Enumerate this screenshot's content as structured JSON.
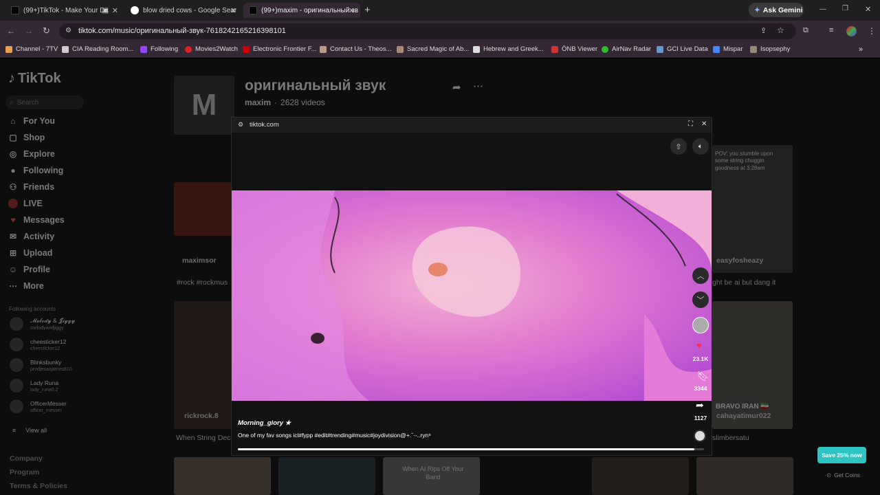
{
  "browser": {
    "tabs": [
      {
        "title": "(99+)TikTok - Make Your Da",
        "active": false
      },
      {
        "title": "blow dried cows - Google Sear",
        "active": false
      },
      {
        "title": "(99+)maxim - оригинальный зв",
        "active": true
      }
    ],
    "new_tab": "+",
    "ask_gemini": "Ask Gemini",
    "url": "tiktok.com/music/оригинальный-звук-7618242165216398101",
    "bookmarks": [
      "Channel - 7TV",
      "CIA Reading Room...",
      "Following",
      "Movies2Watch",
      "Electronic Frontier F...",
      "Contact Us - Theos...",
      "Sacred Magic of Ab...",
      "Hebrew and Greek...",
      "ÖNB Viewer",
      "AirNav Radar",
      "GCI Live Data",
      "Mispar",
      "Isopsephy"
    ],
    "bookmarks_more": "»"
  },
  "sidebar": {
    "logo": "TikTok",
    "search_placeholder": "Search",
    "nav": [
      {
        "label": "For You",
        "icon": "home-icon"
      },
      {
        "label": "Shop",
        "icon": "shop-icon"
      },
      {
        "label": "Explore",
        "icon": "compass-icon"
      },
      {
        "label": "Following",
        "icon": "following-icon"
      },
      {
        "label": "Friends",
        "icon": "friends-icon"
      },
      {
        "label": "LIVE",
        "icon": "live-icon"
      },
      {
        "label": "Messages",
        "icon": "messages-icon"
      },
      {
        "label": "Activity",
        "icon": "activity-icon"
      },
      {
        "label": "Upload",
        "icon": "upload-icon"
      },
      {
        "label": "Profile",
        "icon": "profile-icon"
      },
      {
        "label": "More",
        "icon": "more-icon"
      }
    ],
    "following_header": "Following accounts",
    "accounts": [
      {
        "name": "𝓜𝓮𝓵𝓸𝓭𝔂 & 𝓙𝓲𝓰𝓰𝔂",
        "handle": "melodyandjiggy"
      },
      {
        "name": "cheesticker12",
        "handle": "cheesticker12"
      },
      {
        "name": "Blinksbunky",
        "handle": "prodjesasjames810"
      },
      {
        "name": "Lady Runa",
        "handle": "lady_runa0.2"
      },
      {
        "name": "OfficerMesser",
        "handle": "officer_messer"
      }
    ],
    "view_all": "View all",
    "footer": [
      "Company",
      "Program",
      "Terms & Policies"
    ]
  },
  "sound": {
    "title": "оригинальный звук",
    "author": "maxim",
    "videos": "2628 videos"
  },
  "grid": {
    "captions": {
      "r1_author_left": "maximsor",
      "r1_tags_left": "#rock #rockmus",
      "r1_author_right": "easyfosheazy",
      "r1_text_right": "ght be ai but dang it",
      "r1_overlay_right": "POV: you stumble upon some string chuggin goodness at 3:28am",
      "r2_author_left": "rickrock.8",
      "r2_text_left": "When String Dec",
      "r2_overlay_right": "BRAVO IRAN 🇮🇷",
      "r2_author_right": "cahayatimur022",
      "r2_text_right": "slimbersatu",
      "r3_overlay": "When AI Rips Off Your Band"
    }
  },
  "modal": {
    "origin": "tiktok.com",
    "likes": "23.1K",
    "saves": "3344",
    "shares": "1127",
    "sound_title": "Morning_glory ★",
    "caption": "One of my fav songs icl#fypp #edit#trending#music#joydivision@+.ˇ·-..ryn⁹",
    "progress": 0.98
  },
  "promo": {
    "save_label": "Save 25% now",
    "coins_label": "Get Coins"
  },
  "colors": {
    "tiktok_accent": "#fe2c55",
    "promo": "#2ec4c4",
    "browser_tab_active": "#352835"
  }
}
